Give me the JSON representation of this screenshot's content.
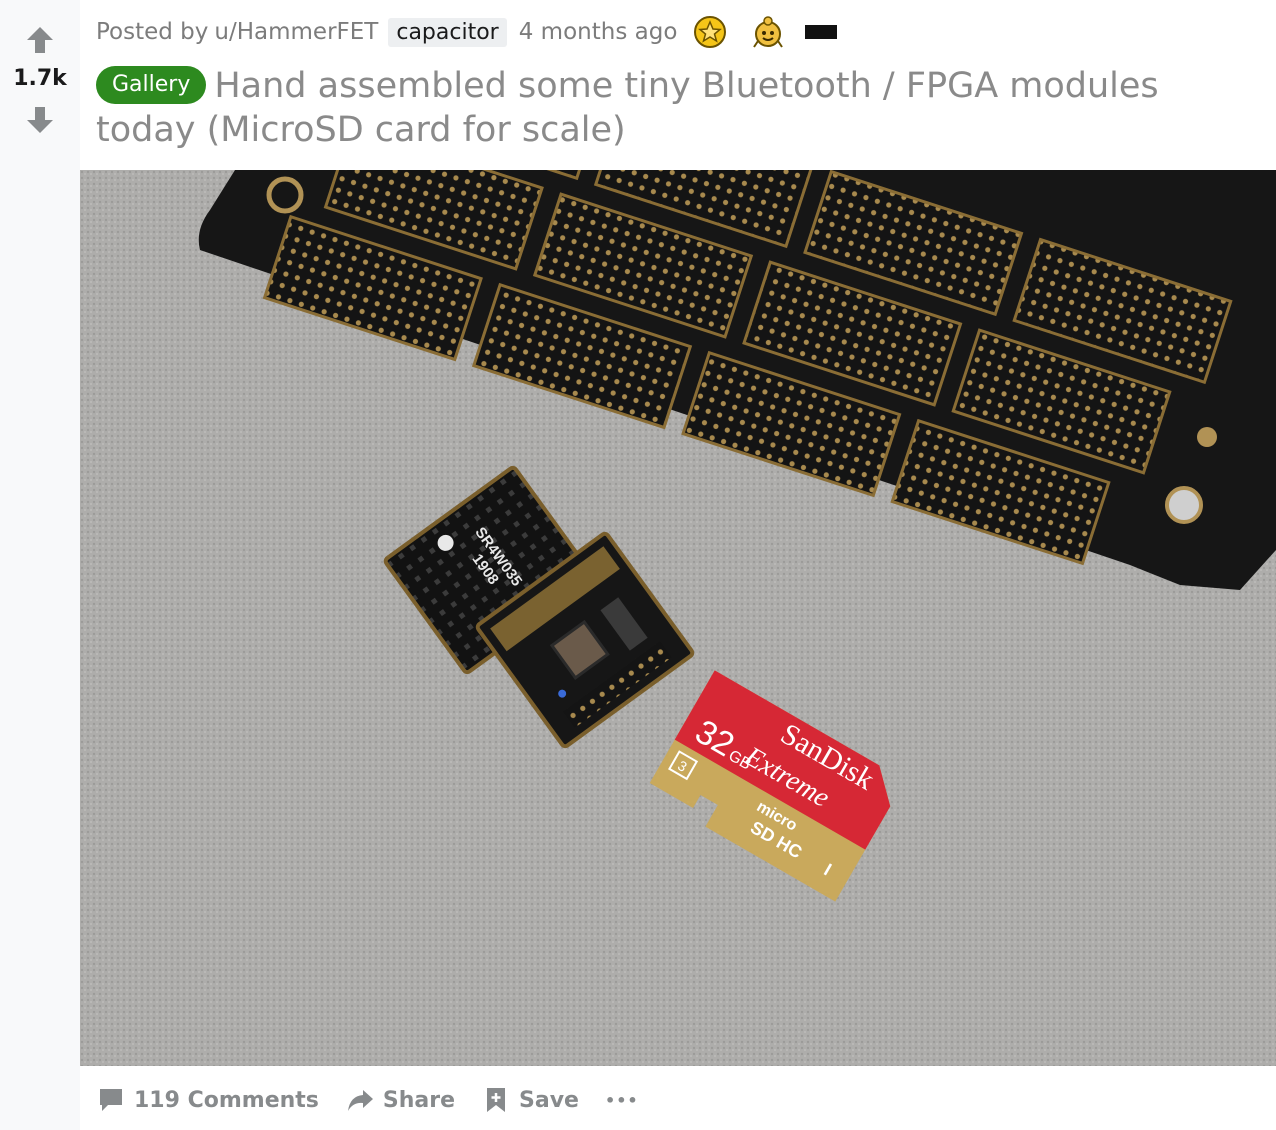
{
  "vote": {
    "score": "1.7k",
    "upvote_icon": "arrow-up-icon",
    "downvote_icon": "arrow-down-icon"
  },
  "post": {
    "posted_by_prefix": "Posted by",
    "author": "u/HammerFET",
    "user_flair": "capacitor",
    "time_ago": "4 months ago",
    "awards": [
      "star-award-icon",
      "wholesome-award-icon",
      "rectangle-award-icon"
    ],
    "post_flair": "Gallery",
    "title": "Hand assembled some tiny Bluetooth / FPGA modules today (MicroSD card for scale)"
  },
  "image": {
    "module_one_lines": [
      "SR4W035",
      "1908"
    ],
    "card_brand": "SanDisk",
    "card_line": "Extreme",
    "card_capacity": "32",
    "card_unit": "GB",
    "card_speed": "3",
    "card_micro": "micro",
    "card_format": "SD",
    "card_hc": "HC",
    "card_class": "I"
  },
  "footer": {
    "comments": "119 Comments",
    "share": "Share",
    "save": "Save",
    "more": "•••"
  },
  "colors": {
    "flair_green": "#2d8a1f",
    "vote_bg": "#f8f9fa",
    "muted_text": "#7c7c7c",
    "card_red": "#d62835",
    "card_gold": "#c9a95c"
  }
}
